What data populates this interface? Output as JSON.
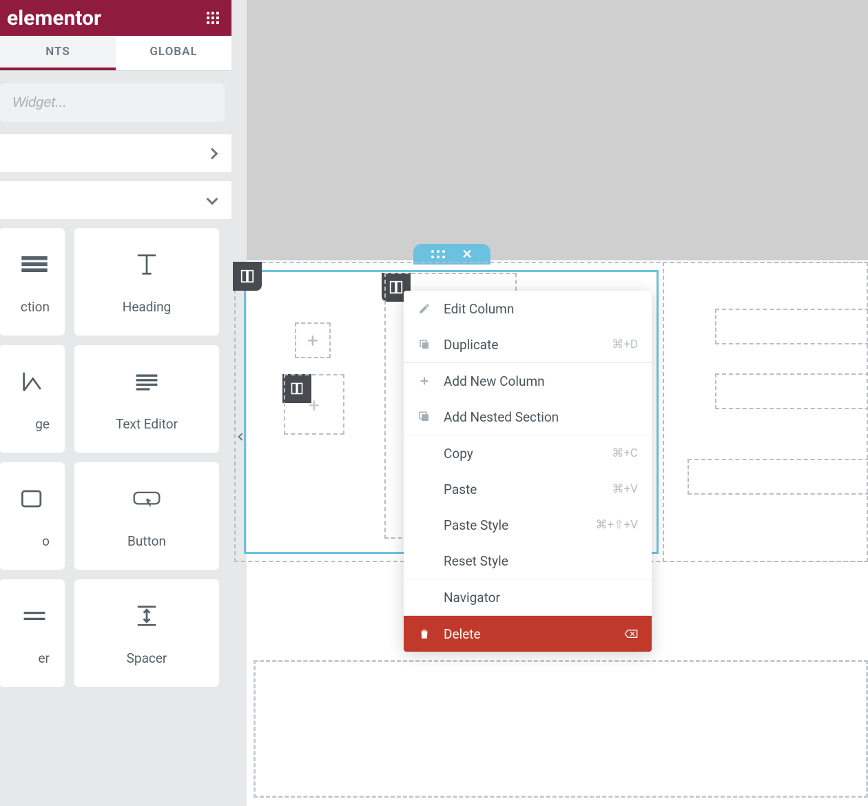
{
  "brand": {
    "name": "elementor"
  },
  "tabs": {
    "elements": "NTS",
    "global": "GLOBAL"
  },
  "search": {
    "placeholder": "Widget..."
  },
  "widgets": {
    "row1": {
      "partial_label": "ction",
      "full_label": "Heading"
    },
    "row2": {
      "partial_label": "ge",
      "full_label": "Text Editor"
    },
    "row3": {
      "partial_label": "o",
      "full_label": "Button"
    },
    "row4": {
      "partial_label": "er",
      "full_label": "Spacer"
    }
  },
  "context_menu": {
    "edit_column": "Edit Column",
    "duplicate": {
      "label": "Duplicate",
      "shortcut": "⌘+D"
    },
    "add_new_column": "Add New Column",
    "add_nested_section": "Add Nested Section",
    "copy": {
      "label": "Copy",
      "shortcut": "⌘+C"
    },
    "paste": {
      "label": "Paste",
      "shortcut": "⌘+V"
    },
    "paste_style": {
      "label": "Paste Style",
      "shortcut": "⌘+⇧+V"
    },
    "reset_style": "Reset Style",
    "navigator": "Navigator",
    "delete": "Delete"
  }
}
